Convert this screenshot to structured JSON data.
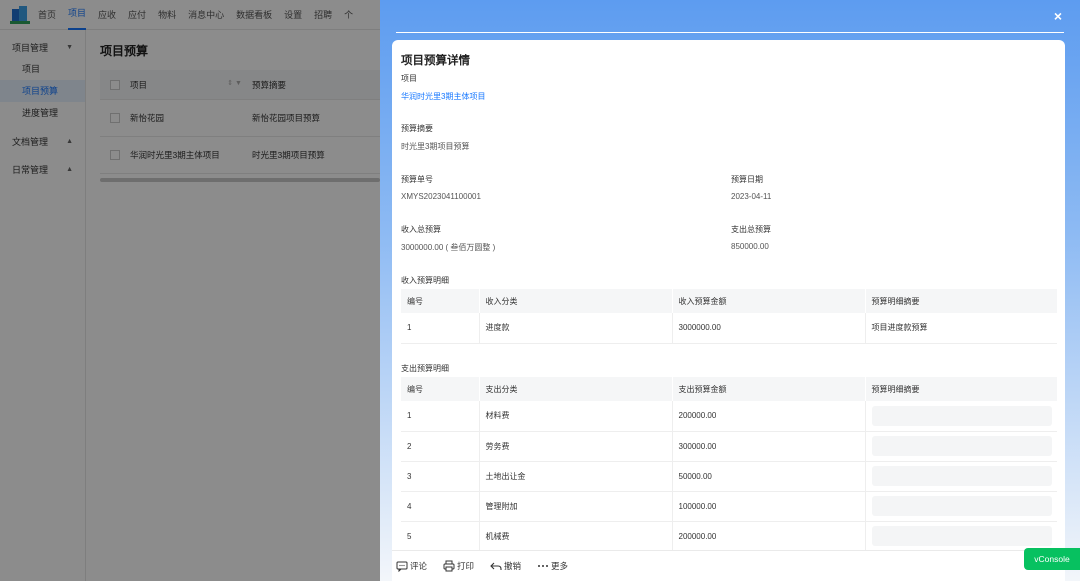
{
  "topnav": {
    "items": [
      "首页",
      "项目",
      "应收",
      "应付",
      "物料",
      "消息中心",
      "数据看板",
      "设置",
      "招聘",
      "个"
    ],
    "active_index": 1
  },
  "sidebar": {
    "groups": [
      {
        "label": "项目管理",
        "caret": "▼",
        "items": [
          "项目",
          "项目预算",
          "进度管理"
        ]
      },
      {
        "label": "文档管理",
        "caret": "▲"
      },
      {
        "label": "日常管理",
        "caret": "▲"
      }
    ],
    "active_item": "项目预算"
  },
  "main": {
    "title": "项目预算",
    "table": {
      "columns": [
        "项目",
        "预算摘要"
      ],
      "rows": [
        [
          "新怡花园",
          "新怡花园项目预算"
        ],
        [
          "华润时光里3期主体项目",
          "时光里3期项目预算"
        ]
      ]
    }
  },
  "drawer": {
    "close_label": "×",
    "title": "项目预算详情",
    "project_label": "项目",
    "project_value": "华润时光里3期主体项目",
    "summary_label": "预算摘要",
    "summary_value": "时光里3期项目预算",
    "budget_no_label": "预算单号",
    "budget_no_value": "XMYS2023041100001",
    "budget_date_label": "预算日期",
    "budget_date_value": "2023-04-11",
    "income_total_label": "收入总预算",
    "income_total_value": "3000000.00 ( 叁佰万圆整 )",
    "expense_total_label": "支出总预算",
    "expense_total_value": "850000.00",
    "income_section": {
      "title": "收入预算明细",
      "columns": [
        "编号",
        "收入分类",
        "收入预算金额",
        "预算明细摘要"
      ],
      "rows": [
        [
          "1",
          "进度款",
          "3000000.00",
          "项目进度款预算"
        ]
      ]
    },
    "expense_section": {
      "title": "支出预算明细",
      "columns": [
        "编号",
        "支出分类",
        "支出预算金额",
        "预算明细摘要"
      ],
      "rows": [
        [
          "1",
          "材料费",
          "200000.00",
          ""
        ],
        [
          "2",
          "劳务费",
          "300000.00",
          ""
        ],
        [
          "3",
          "土地出让金",
          "50000.00",
          ""
        ],
        [
          "4",
          "管理附加",
          "100000.00",
          ""
        ],
        [
          "5",
          "机械费",
          "200000.00",
          ""
        ]
      ]
    },
    "footer": {
      "comment": "评论",
      "print": "打印",
      "revoke": "撤销",
      "more": "更多"
    }
  },
  "vconsole": "vConsole",
  "colors": {
    "accent": "#1677ff",
    "drawer_gradient_top": "#5d9cf0",
    "vconsole": "#07c160"
  }
}
